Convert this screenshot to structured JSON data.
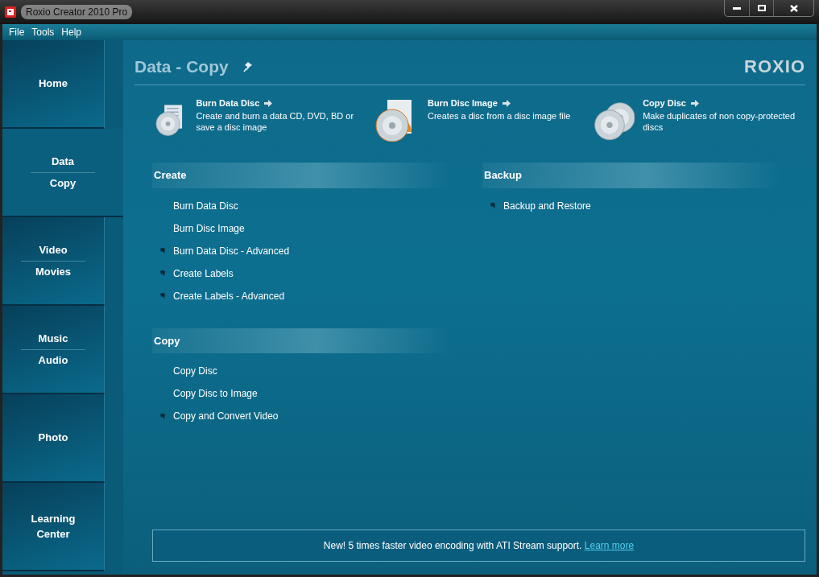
{
  "window": {
    "title": "Roxio Creator 2010 Pro"
  },
  "menu": [
    "File",
    "Tools",
    "Help"
  ],
  "sidebar": {
    "items": [
      {
        "lines": [
          "Home"
        ],
        "selected": false
      },
      {
        "lines": [
          "Data",
          "Copy"
        ],
        "selected": true
      },
      {
        "lines": [
          "Video",
          "Movies"
        ],
        "selected": false
      },
      {
        "lines": [
          "Music",
          "Audio"
        ],
        "selected": false
      },
      {
        "lines": [
          "Photo"
        ],
        "selected": false
      },
      {
        "lines": [
          "Learning Center"
        ],
        "selected": false
      }
    ]
  },
  "page": {
    "title": "Data - Copy",
    "logo": "ROXIO"
  },
  "features": [
    {
      "kind": "data",
      "title": "Burn Data Disc",
      "description": "Create and burn a data CD, DVD, BD or save a disc image"
    },
    {
      "kind": "image",
      "title": "Burn Disc Image",
      "description": "Creates a disc from a disc image file"
    },
    {
      "kind": "copy",
      "title": "Copy Disc",
      "description": "Make duplicates of non copy-protected discs"
    }
  ],
  "task_columns": [
    {
      "sections": [
        {
          "title": "Create",
          "items": [
            {
              "label": "Burn Data Disc",
              "kind": "plain"
            },
            {
              "label": "Burn Disc Image",
              "kind": "plain"
            },
            {
              "label": "Burn Data Disc - Advanced",
              "kind": "extra"
            },
            {
              "label": "Create Labels",
              "kind": "extra"
            },
            {
              "label": "Create Labels - Advanced",
              "kind": "extra"
            }
          ]
        },
        {
          "title": "Copy",
          "items": [
            {
              "label": "Copy Disc",
              "kind": "plain"
            },
            {
              "label": "Copy Disc to Image",
              "kind": "plain"
            },
            {
              "label": "Copy and Convert Video",
              "kind": "extra"
            }
          ]
        }
      ]
    },
    {
      "sections": [
        {
          "title": "Backup",
          "items": [
            {
              "label": "Backup and Restore",
              "kind": "extra"
            }
          ]
        }
      ]
    }
  ],
  "banner": {
    "text": "New! 5 times faster video encoding with ATI Stream support.",
    "link": "Learn more"
  }
}
